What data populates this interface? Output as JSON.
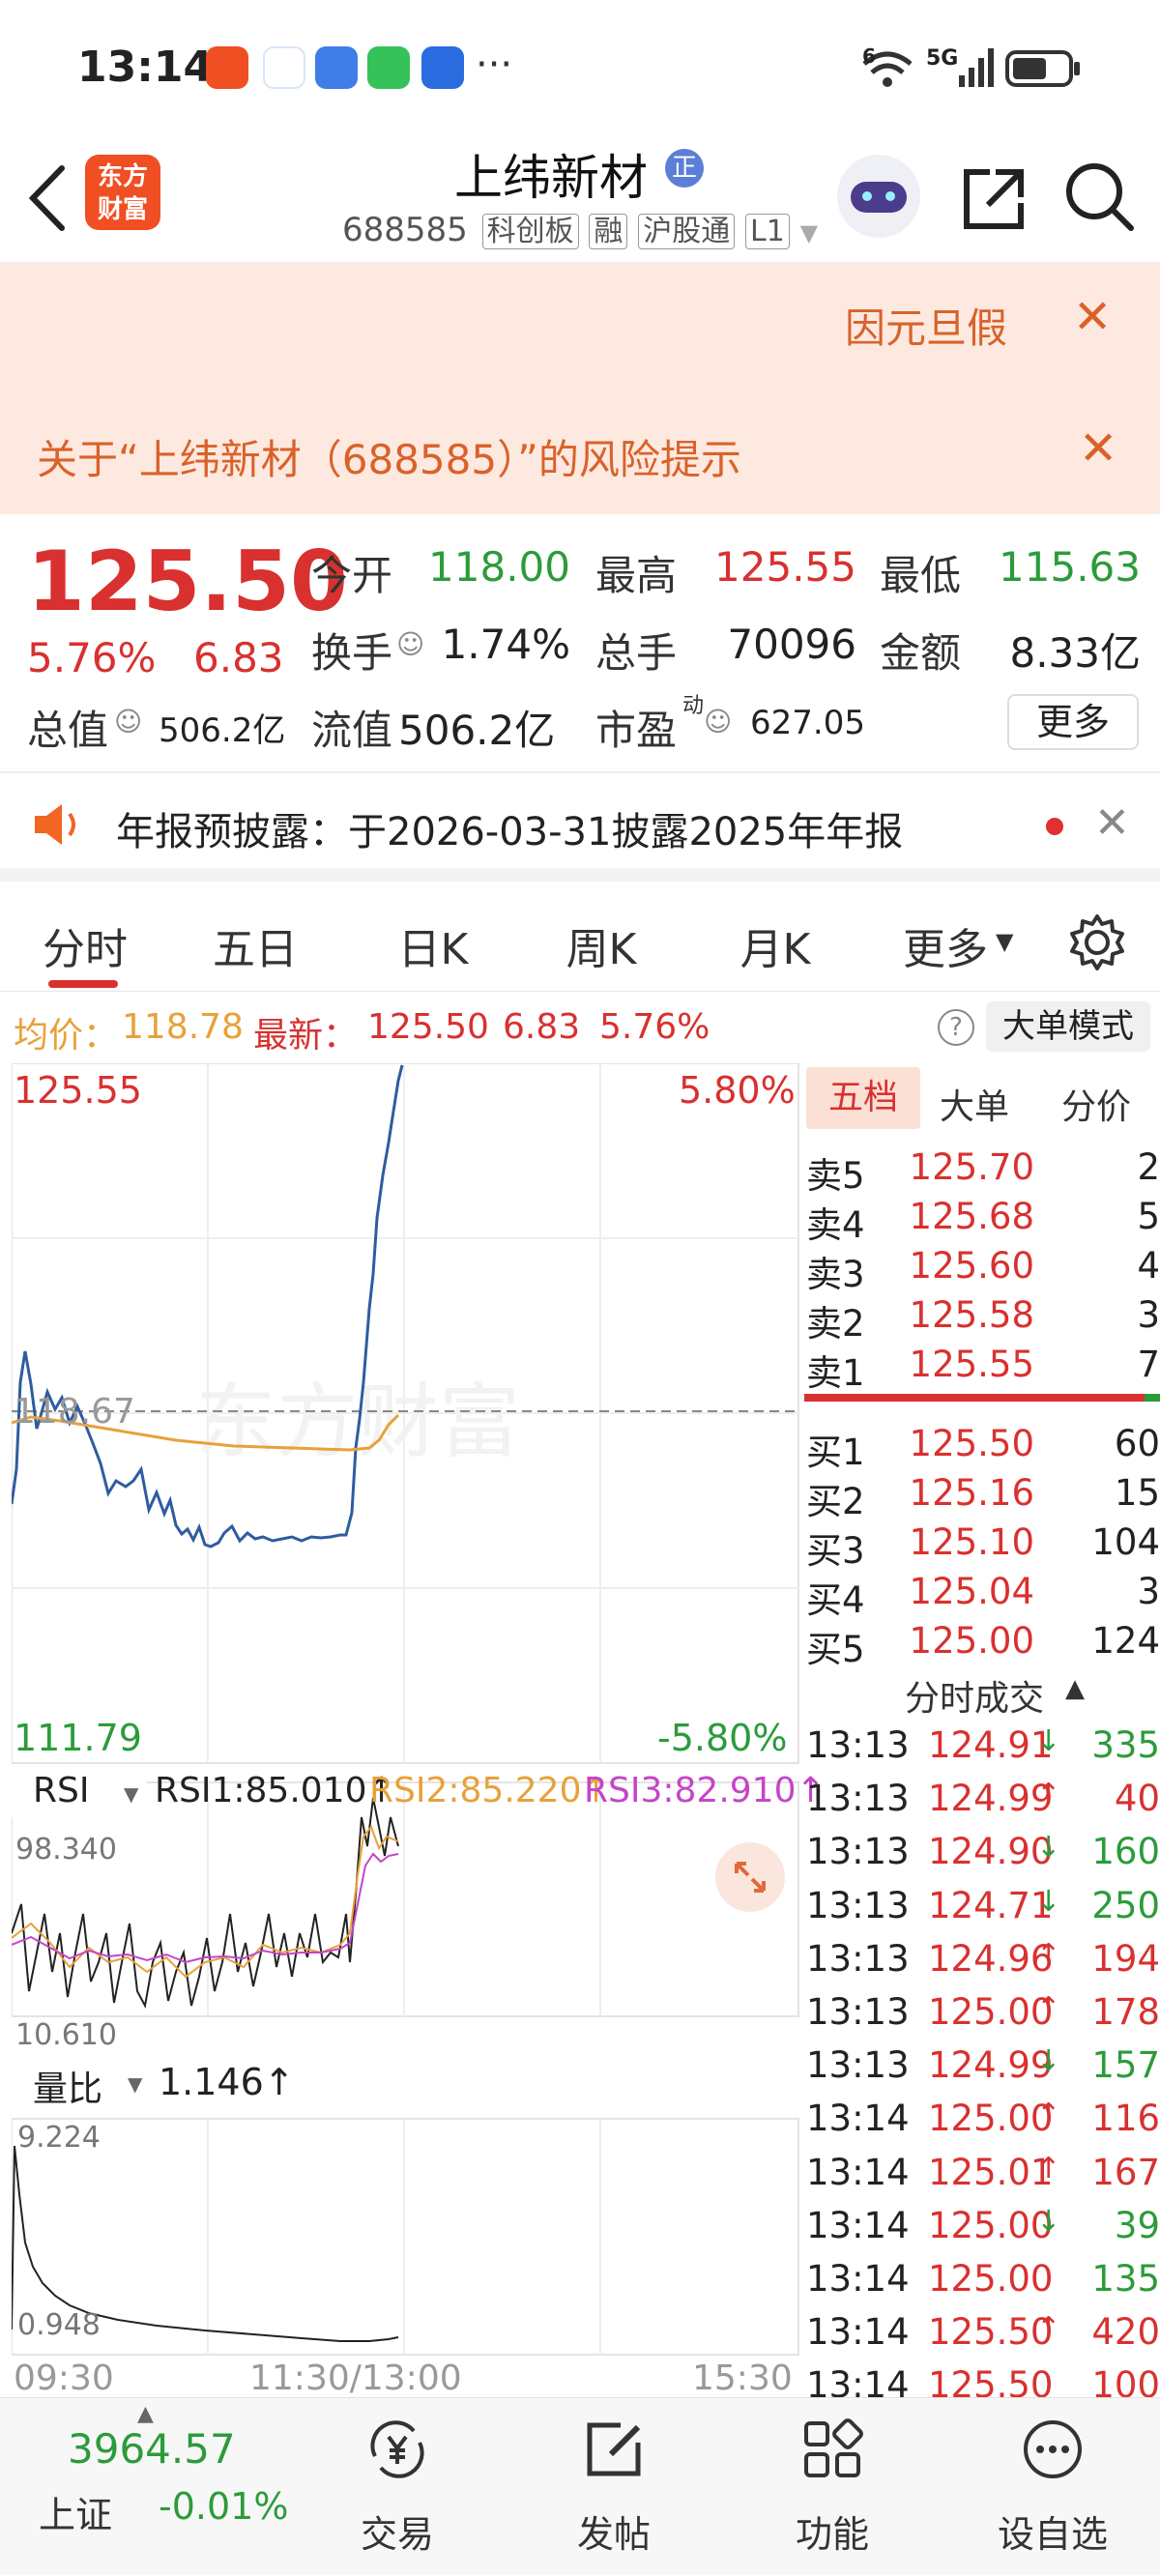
{
  "status_bar": {
    "time": "13:14",
    "overflow": "···",
    "wifi_badge": "6",
    "signal": "5G"
  },
  "header": {
    "back_icon": "chevron-left-icon",
    "logo_line1": "东方",
    "logo_line2": "财富",
    "stock_name": "上纬新材",
    "name_badge": "正",
    "code": "688585",
    "tags": [
      "科创板",
      "融",
      "沪股通",
      "L1"
    ]
  },
  "banner": {
    "notice1": "因元旦假",
    "notice2": "关于“上纬新材（688585）”的风险提示"
  },
  "quote": {
    "price": "125.50",
    "change_pct": "5.76%",
    "change": "6.83",
    "open_label": "今开",
    "open": "118.00",
    "high_label": "最高",
    "high": "125.55",
    "low_label": "最低",
    "low": "115.63",
    "turnover_label": "换手",
    "turnover": "1.74%",
    "volume_label": "总手",
    "volume": "70096",
    "amount_label": "金额",
    "amount": "8.33亿",
    "mktcap_label": "总值",
    "mktcap": "506.2亿",
    "float_label": "流值",
    "float_cap": "506.2亿",
    "pe_label": "市盈",
    "pe_sup": "动",
    "pe": "627.05",
    "more_label": "更多"
  },
  "notice": {
    "text": "年报预披露：于2026-03-31披露2025年年报"
  },
  "tabs": {
    "items": [
      "分时",
      "五日",
      "日K",
      "周K",
      "月K",
      "更多"
    ],
    "active": 0
  },
  "avg_bar": {
    "avg_label": "均价：",
    "avg": "118.78",
    "latest_label": "最新：",
    "latest": "125.50",
    "chg": "6.83",
    "pct": "5.76%",
    "mode_button": "大单模式"
  },
  "chart": {
    "y_top": "125.55",
    "y_bottom": "111.79",
    "pct_top": "5.80%",
    "pct_bottom": "-5.80%",
    "prev_close": "118.67",
    "watermark": "东方财富",
    "rsi_label": "RSI",
    "rsi1": "RSI1:85.010↑",
    "rsi2": "RSI2:85.220↑",
    "rsi3": "RSI3:82.910↑",
    "rsi_top": "98.340",
    "rsi_bottom": "10.610",
    "vr_label": "量比",
    "vr_value": "1.146↑",
    "vr_top": "9.224",
    "vr_bottom": "0.948",
    "t_start": "09:30",
    "t_mid": "11:30/13:00",
    "t_end": "15:30",
    "colors": {
      "price_line": "#2f5c9e",
      "avg_line": "#e8a13a",
      "rsi1": "#222222",
      "rsi2": "#e8a13a",
      "rsi3": "#c545c8"
    }
  },
  "book": {
    "tabs": [
      "五档",
      "大单",
      "分价"
    ],
    "sells": [
      {
        "label": "卖5",
        "price": "125.70",
        "vol": "2"
      },
      {
        "label": "卖4",
        "price": "125.68",
        "vol": "5"
      },
      {
        "label": "卖3",
        "price": "125.60",
        "vol": "4"
      },
      {
        "label": "卖2",
        "price": "125.58",
        "vol": "3"
      },
      {
        "label": "卖1",
        "price": "125.55",
        "vol": "7"
      }
    ],
    "buys": [
      {
        "label": "买1",
        "price": "125.50",
        "vol": "60"
      },
      {
        "label": "买2",
        "price": "125.16",
        "vol": "15"
      },
      {
        "label": "买3",
        "price": "125.10",
        "vol": "104"
      },
      {
        "label": "买4",
        "price": "125.04",
        "vol": "3"
      },
      {
        "label": "买5",
        "price": "125.00",
        "vol": "124"
      }
    ],
    "trades_header": "分时成交",
    "trades": [
      {
        "time": "13:13",
        "price": "124.91",
        "arrow": "↓",
        "vol": "335",
        "dir": "down"
      },
      {
        "time": "13:13",
        "price": "124.99",
        "arrow": "↑",
        "vol": "40",
        "dir": "up"
      },
      {
        "time": "13:13",
        "price": "124.90",
        "arrow": "↓",
        "vol": "160",
        "dir": "down"
      },
      {
        "time": "13:13",
        "price": "124.71",
        "arrow": "↓",
        "vol": "250",
        "dir": "down"
      },
      {
        "time": "13:13",
        "price": "124.96",
        "arrow": "↑",
        "vol": "194",
        "dir": "up"
      },
      {
        "time": "13:13",
        "price": "125.00",
        "arrow": "↑",
        "vol": "178",
        "dir": "up"
      },
      {
        "time": "13:13",
        "price": "124.99",
        "arrow": "↓",
        "vol": "157",
        "dir": "down"
      },
      {
        "time": "13:14",
        "price": "125.00",
        "arrow": "↑",
        "vol": "116",
        "dir": "up"
      },
      {
        "time": "13:14",
        "price": "125.01",
        "arrow": "↑",
        "vol": "167",
        "dir": "up"
      },
      {
        "time": "13:14",
        "price": "125.00",
        "arrow": "↓",
        "vol": "39",
        "dir": "down"
      },
      {
        "time": "13:14",
        "price": "125.00",
        "arrow": "",
        "vol": "135",
        "dir": "down"
      },
      {
        "time": "13:14",
        "price": "125.50",
        "arrow": "↑",
        "vol": "420",
        "dir": "up"
      },
      {
        "time": "13:14",
        "price": "125.50",
        "arrow": "",
        "vol": "100",
        "dir": "up"
      }
    ]
  },
  "bottom_nav": {
    "index_value": "3964.57",
    "index_name": "上证",
    "index_change": "-0.01%",
    "items": [
      {
        "label": "交易",
        "icon": "yen-cycle-icon"
      },
      {
        "label": "发帖",
        "icon": "edit-icon"
      },
      {
        "label": "功能",
        "icon": "grid-icon"
      },
      {
        "label": "设自选",
        "icon": "more-circle-icon"
      }
    ]
  }
}
